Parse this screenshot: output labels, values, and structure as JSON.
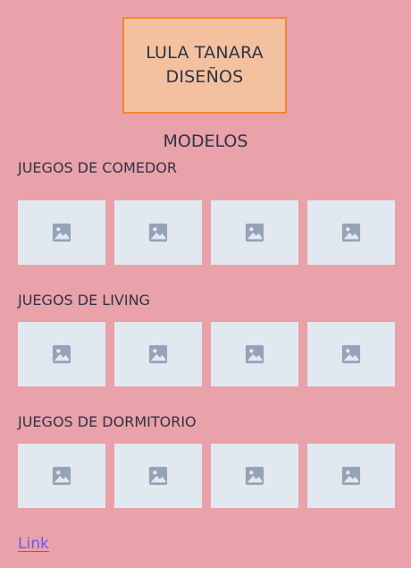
{
  "logo": {
    "line1": "LULA TANARA",
    "line2": "DISEÑOS"
  },
  "models_title": "MODELOS",
  "sections": [
    {
      "title": "JUEGOS DE COMEDOR",
      "images": [
        "image-icon",
        "image-icon",
        "image-icon",
        "image-icon"
      ]
    },
    {
      "title": "JUEGOS DE LIVING",
      "images": [
        "image-icon",
        "image-icon",
        "image-icon",
        "image-icon"
      ]
    },
    {
      "title": "JUEGOS DE DORMITORIO",
      "images": [
        "image-icon",
        "image-icon",
        "image-icon",
        "image-icon"
      ]
    }
  ],
  "link_label": "Link",
  "colors": {
    "background": "#e9a1aa",
    "logo_fill": "#f3c19f",
    "logo_border": "#f0892f",
    "thumb_fill": "#e2e8f0",
    "icon": "#94a3b8",
    "link": "#6b5bf0"
  }
}
